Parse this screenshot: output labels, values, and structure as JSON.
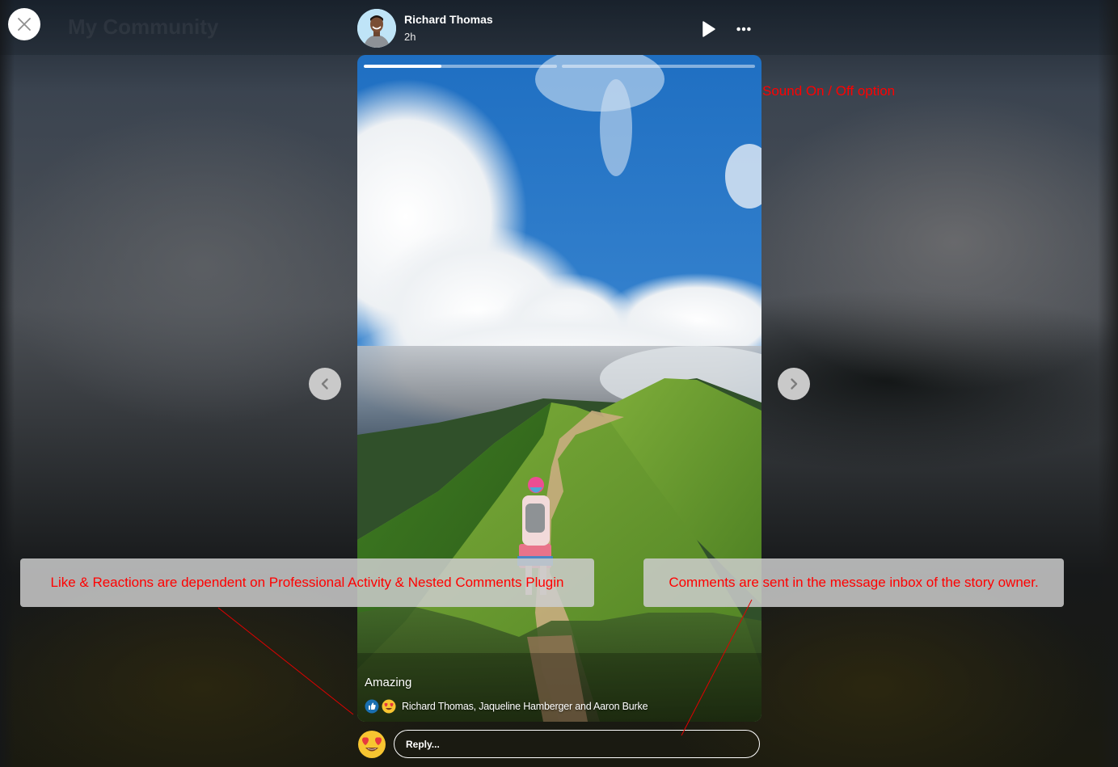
{
  "background": {
    "ghost_site_title": "My Community"
  },
  "close_button": {
    "icon": "close-icon",
    "label": "Close"
  },
  "story": {
    "author": "Richard Thomas",
    "posted_ago": "2h",
    "controls": {
      "play_icon": "play-icon",
      "more_icon": "more-horizontal-icon"
    },
    "segments": [
      {
        "progress": 0.4,
        "state": "playing"
      },
      {
        "progress": 0.0,
        "state": "upcoming"
      }
    ],
    "caption": "Amazing",
    "reactions": {
      "icons": [
        "like-icon",
        "heart-eyes-icon"
      ],
      "reactors_text": "Richard Thomas, Jaqueline Hamberger and Aaron Burke"
    },
    "image_description": "Hiker walking along a grassy mountain ridge trail under a blue sky with clouds"
  },
  "navigation": {
    "prev_icon": "chevron-left-icon",
    "next_icon": "chevron-right-icon"
  },
  "reply": {
    "reaction_picker_icon": "heart-eyes-icon",
    "placeholder": "Reply...",
    "value": ""
  },
  "annotations": {
    "sound": "Sound On / Off option",
    "reactions": "Like & Reactions are dependent on Professional Activity & Nested Comments Plugin",
    "comments": "Comments are sent in the message inbox of the story owner."
  },
  "colors": {
    "annotation_text": "#ff0000",
    "annotation_bg": "#cdcdcd",
    "progress_fill": "#ffffff",
    "like_blue": "#1a6fb0",
    "emoji_yellow": "#f7c531"
  }
}
